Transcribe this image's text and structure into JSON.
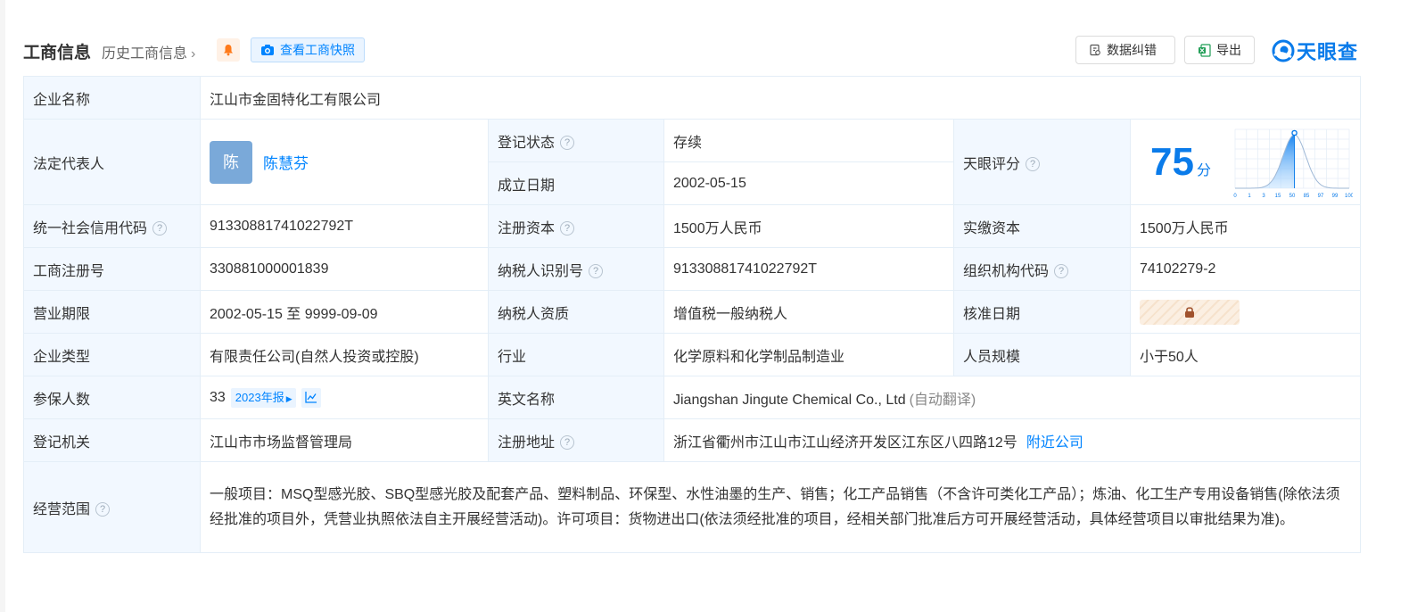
{
  "header": {
    "title": "工商信息",
    "history_link": "历史工商信息",
    "snapshot_button": "查看工商快照",
    "correct_button": "数据纠错",
    "export_button": "导出",
    "logo_text": "天眼查"
  },
  "colors": {
    "accent": "#0084ff",
    "status_green": "#1fa05a",
    "label_bg": "#f2f8ff",
    "border": "#e4eef7"
  },
  "info": {
    "company_name_label": "企业名称",
    "company_name": "江山市金固特化工有限公司",
    "legal_rep_label": "法定代表人",
    "legal_rep_avatar": "陈",
    "legal_rep_name": "陈慧芬",
    "reg_status_label": "登记状态",
    "reg_status": "存续",
    "founded_label": "成立日期",
    "founded": "2002-05-15",
    "score_label": "天眼评分",
    "score": "75",
    "score_unit": "分",
    "credit_code_label": "统一社会信用代码",
    "credit_code": "91330881741022792T",
    "reg_capital_label": "注册资本",
    "reg_capital": "1500万人民币",
    "paid_capital_label": "实缴资本",
    "paid_capital": "1500万人民币",
    "reg_no_label": "工商注册号",
    "reg_no": "330881000001839",
    "taxpayer_id_label": "纳税人识别号",
    "taxpayer_id": "91330881741022792T",
    "org_code_label": "组织机构代码",
    "org_code": "74102279-2",
    "term_label": "营业期限",
    "term": "2002-05-15 至 9999-09-09",
    "taxpayer_qual_label": "纳税人资质",
    "taxpayer_qual": "增值税一般纳税人",
    "approve_date_label": "核准日期",
    "type_label": "企业类型",
    "type": "有限责任公司(自然人投资或控股)",
    "industry_label": "行业",
    "industry": "化学原料和化学制品制造业",
    "staff_label": "人员规模",
    "staff": "小于50人",
    "insured_label": "参保人数",
    "insured": "33",
    "insured_year_tag": "2023年报",
    "english_name_label": "英文名称",
    "english_name": "Jiangshan Jingute Chemical Co., Ltd",
    "english_name_note": "(自动翻译)",
    "authority_label": "登记机关",
    "authority": "江山市市场监督管理局",
    "address_label": "注册地址",
    "address": "浙江省衢州市江山市江山经济开发区江东区八四路12号",
    "nearby_link": "附近公司",
    "scope_label": "经营范围",
    "scope": "一般项目：MSQ型感光胶、SBQ型感光胶及配套产品、塑料制品、环保型、水性油墨的生产、销售；化工产品销售（不含许可类化工产品）；炼油、化工生产专用设备销售(除依法须经批准的项目外，凭营业执照依法自主开展经营活动)。许可项目：货物进出口(依法须经批准的项目，经相关部门批准后方可开展经营活动，具体经营项目以审批结果为准)。"
  },
  "score_chart": {
    "type": "area",
    "x_ticks": [
      "0",
      "1",
      "3",
      "15",
      "50",
      "85",
      "97",
      "99",
      "100"
    ],
    "marker_x": "75"
  }
}
